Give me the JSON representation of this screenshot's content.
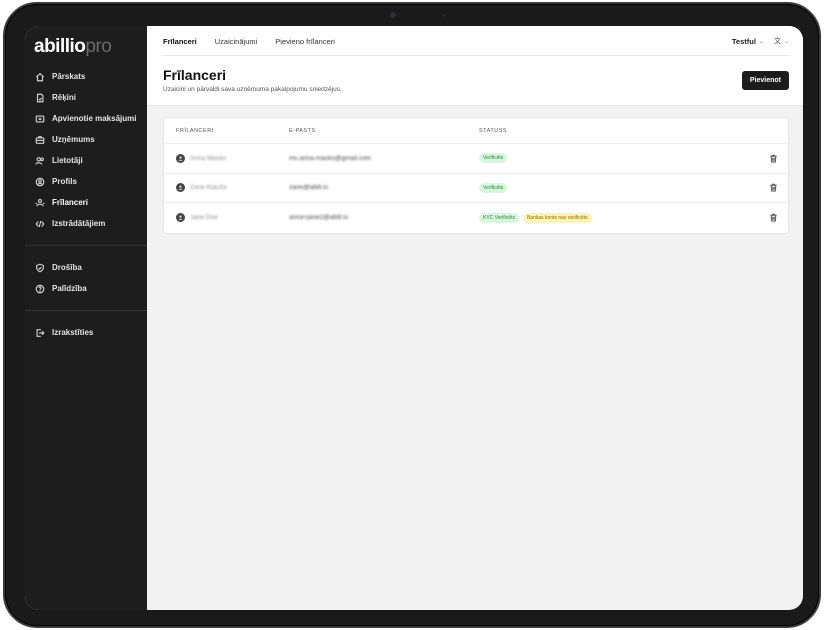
{
  "brand": {
    "logo_main": "abillio",
    "logo_suffix": "pro"
  },
  "sidebar": {
    "items": [
      {
        "label": "Pārskats",
        "icon": "home-icon"
      },
      {
        "label": "Rēķini",
        "icon": "document-icon"
      },
      {
        "label": "Apvienotie maksājumi",
        "icon": "payments-icon"
      },
      {
        "label": "Uzņēmums",
        "icon": "briefcase-icon"
      },
      {
        "label": "Lietotāji",
        "icon": "users-icon"
      },
      {
        "label": "Profils",
        "icon": "profile-icon"
      },
      {
        "label": "Frīlanceri",
        "icon": "freelancers-icon",
        "active": true
      },
      {
        "label": "Izstrādātājiem",
        "icon": "code-icon"
      }
    ],
    "secondary": [
      {
        "label": "Drošība",
        "icon": "shield-icon"
      },
      {
        "label": "Palīdzība",
        "icon": "help-icon"
      }
    ],
    "logout": {
      "label": "Izrakstīties",
      "icon": "logout-icon"
    }
  },
  "topbar": {
    "tabs": [
      {
        "label": "Frīlanceri",
        "active": true
      },
      {
        "label": "Uzaicinājumi",
        "active": false
      },
      {
        "label": "Pievieno frīlanceri",
        "active": false
      }
    ],
    "user": "Testful",
    "lang_icon": "translate-icon"
  },
  "header": {
    "title": "Frīlanceri",
    "subtitle": "Uzaicini un pārvaldi sava uzņēmuma pakalpojumu sniedzējus.",
    "add_button": "Pievienot"
  },
  "table": {
    "columns": [
      "FRĪLANCERI",
      "E-PASTS",
      "STATUSS"
    ],
    "rows": [
      {
        "name": "Anna Macko",
        "email": "ms.anna.macko@gmail.com",
        "badges": [
          {
            "text": "Verificēts",
            "color": "green"
          }
        ]
      },
      {
        "name": "Zane Klauža",
        "email": "zane@abill.io",
        "badges": [
          {
            "text": "Verificēts",
            "color": "green"
          }
        ]
      },
      {
        "name": "Jane Doe",
        "email": "anna+jane2@abill.io",
        "badges": [
          {
            "text": "KYC Verificēts",
            "color": "green"
          },
          {
            "text": "Bankas konts nav verificēts",
            "color": "yellow"
          }
        ]
      }
    ]
  },
  "colors": {
    "sidebar_bg": "#1d1d1d",
    "accent": "#1c1c1c",
    "badge_green": "#d9f5dd",
    "badge_yellow": "#fdf3b8"
  }
}
